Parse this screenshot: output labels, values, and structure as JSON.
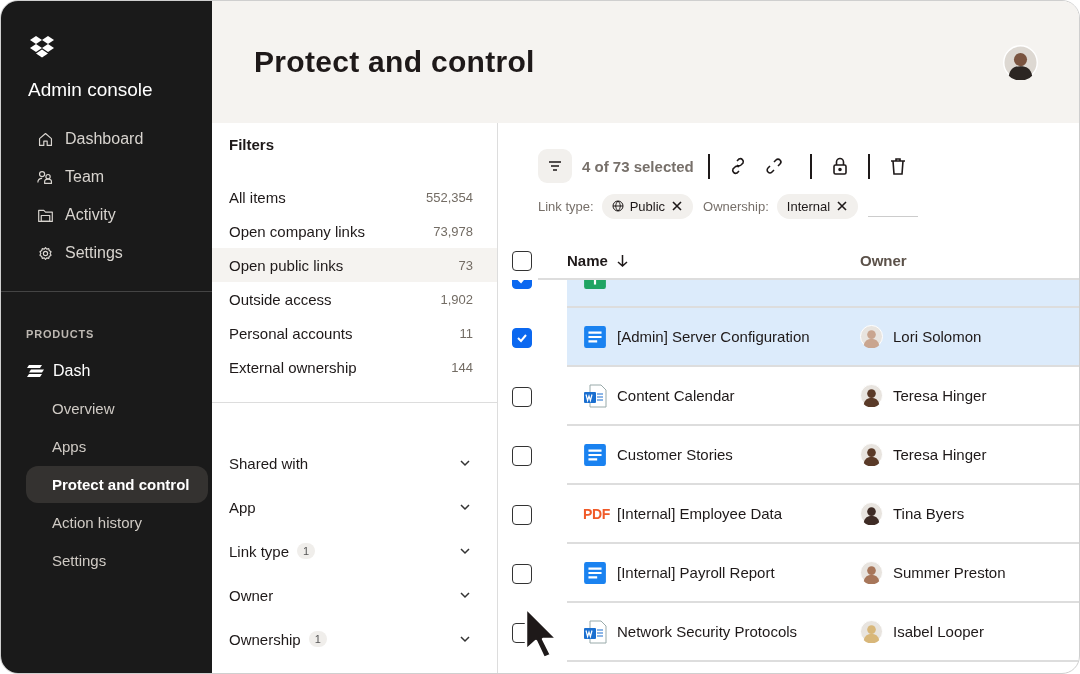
{
  "sidebar": {
    "title": "Admin console",
    "nav": [
      {
        "label": "Dashboard"
      },
      {
        "label": "Team"
      },
      {
        "label": "Activity"
      },
      {
        "label": "Settings"
      }
    ],
    "section_label": "PRODUCTS",
    "product": {
      "label": "Dash",
      "items": [
        {
          "label": "Overview",
          "selected": false
        },
        {
          "label": "Apps",
          "selected": false
        },
        {
          "label": "Protect and control",
          "selected": true
        },
        {
          "label": "Action history",
          "selected": false
        },
        {
          "label": "Settings",
          "selected": false
        }
      ]
    }
  },
  "header": {
    "title": "Protect and control"
  },
  "filters": {
    "title": "Filters",
    "presets": [
      {
        "label": "All items",
        "count": "552,354",
        "selected": false
      },
      {
        "label": "Open company links",
        "count": "73,978",
        "selected": false
      },
      {
        "label": "Open public links",
        "count": "73",
        "selected": true
      },
      {
        "label": "Outside access",
        "count": "1,902",
        "selected": false
      },
      {
        "label": "Personal accounts",
        "count": "11",
        "selected": false
      },
      {
        "label": "External ownership",
        "count": "144",
        "selected": false
      }
    ],
    "groups": [
      {
        "label": "Shared with"
      },
      {
        "label": "App"
      },
      {
        "label": "Link type",
        "badge": "1"
      },
      {
        "label": "Owner"
      },
      {
        "label": "Ownership",
        "badge": "1"
      }
    ]
  },
  "toolbar": {
    "selection": "4 of 73 selected"
  },
  "active_filters": [
    {
      "label": "Link type:",
      "value": "Public"
    },
    {
      "label": "Ownership:",
      "value": "Internal"
    }
  ],
  "table": {
    "columns": [
      {
        "label": "Name"
      },
      {
        "label": "Owner"
      }
    ],
    "header_checked": false,
    "rows": [
      {
        "kind": "sheet",
        "checked": true
      },
      {
        "name": "[Admin] Server Configuration",
        "owner": "Lori Solomon",
        "kind": "doc",
        "checked": true,
        "color": "#c9a58f"
      },
      {
        "name": "Content Calendar",
        "owner": "Teresa Hinger",
        "kind": "word",
        "checked": false,
        "color": "#5a3a28"
      },
      {
        "name": "Customer Stories",
        "owner": "Teresa Hinger",
        "kind": "doc",
        "checked": false,
        "color": "#5a3a28"
      },
      {
        "name": "[Internal] Employee Data",
        "owner": "Tina Byers",
        "kind": "pdf",
        "file_label": "PDF",
        "checked": false,
        "color": "#3e2b25"
      },
      {
        "name": "[Internal] Payroll Report",
        "owner": "Summer Preston",
        "kind": "doc",
        "checked": false,
        "color": "#a7765a"
      },
      {
        "name": "Network Security Protocols",
        "owner": "Isabel Looper",
        "kind": "word",
        "checked": false,
        "color": "#d8b77a"
      }
    ]
  }
}
